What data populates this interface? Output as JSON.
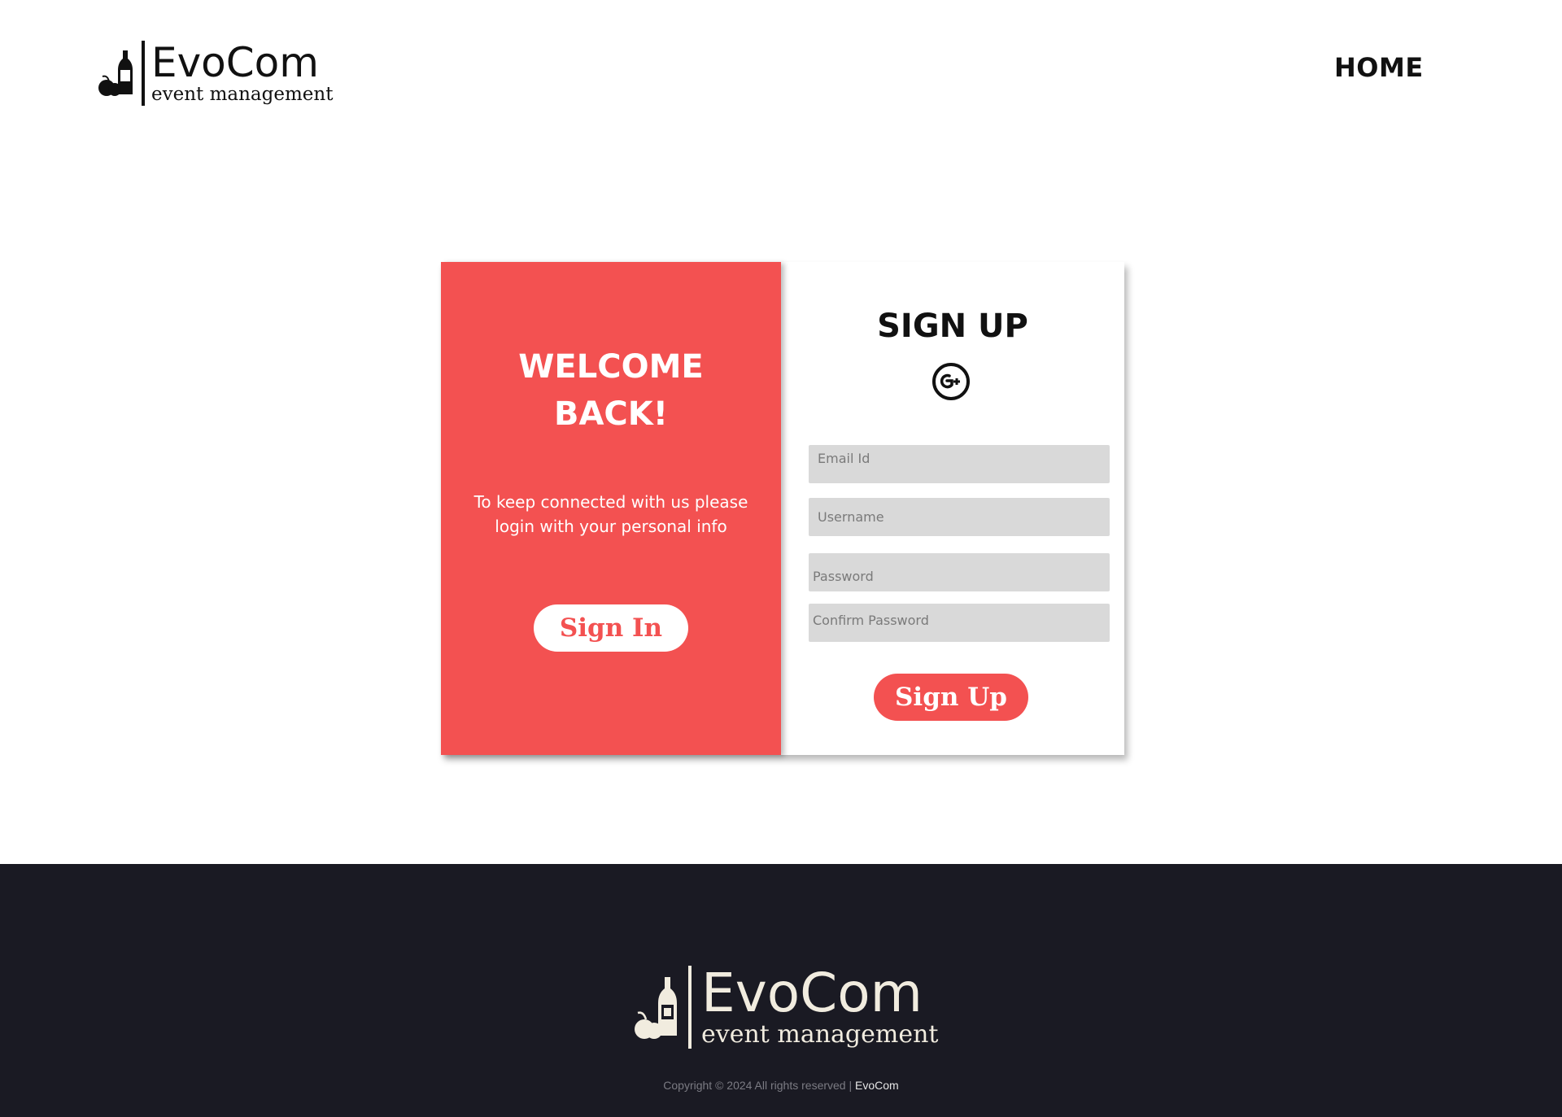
{
  "header": {
    "logo": {
      "brand": "EvoCom",
      "tagline": "event management"
    },
    "nav": {
      "home_label": "HOME"
    }
  },
  "welcome_panel": {
    "title_line1": "WELCOME",
    "title_line2": "BACK!",
    "message": "To keep connected with us please login with your personal info",
    "signin_label": "Sign In"
  },
  "signup_panel": {
    "title": "SIGN UP",
    "social_icon": "google-plus-icon",
    "fields": {
      "email_placeholder": "Email Id",
      "username_placeholder": "Username",
      "password_placeholder": "Password",
      "confirm_placeholder": "Confirm Password"
    },
    "signup_label": "Sign Up"
  },
  "footer": {
    "logo": {
      "brand": "EvoCom",
      "tagline": "event management"
    },
    "copyright_prefix": "Copyright © 2024 All rights reserved |",
    "copyright_link": "EvoCom"
  },
  "colors": {
    "accent": "#f35151",
    "footer_bg": "#1a1a23",
    "field_bg": "#d9d9d9"
  }
}
